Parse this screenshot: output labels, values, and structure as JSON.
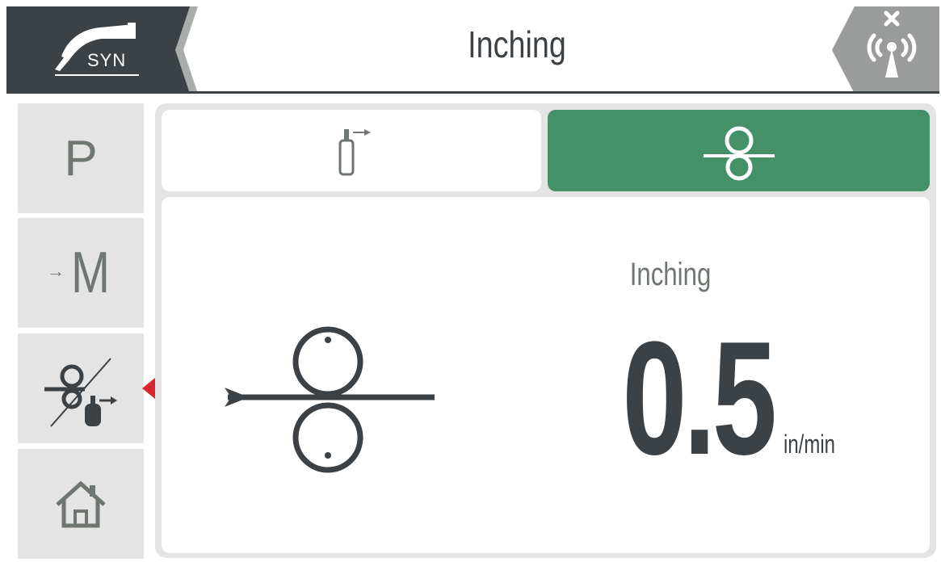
{
  "header": {
    "syn_label": "SYN",
    "title": "Inching",
    "left_icon": "torch-icon",
    "back_icon": "chevron-left-icon",
    "status_icon": "wireless-disconnected-icon"
  },
  "sidebar": {
    "items": [
      {
        "label": "P",
        "icon": "program-icon"
      },
      {
        "label": "M",
        "icon": "memory-load-icon"
      },
      {
        "label": "",
        "icon": "inching-gas-test-icon"
      },
      {
        "label": "",
        "icon": "home-icon"
      }
    ],
    "active_index": 2
  },
  "tabs": [
    {
      "icon": "gas-test-icon",
      "active": false
    },
    {
      "icon": "wire-feed-icon",
      "active": true
    }
  ],
  "main": {
    "label": "Inching",
    "value": "0.5",
    "unit": "in/min",
    "icon": "wire-feed-rollers-icon"
  },
  "colors": {
    "dark": "#3c4145",
    "accent_green": "#449167",
    "panel_gray": "#e4e4e4",
    "icon_gray": "#6e766f",
    "marker_red": "#d9262c"
  }
}
